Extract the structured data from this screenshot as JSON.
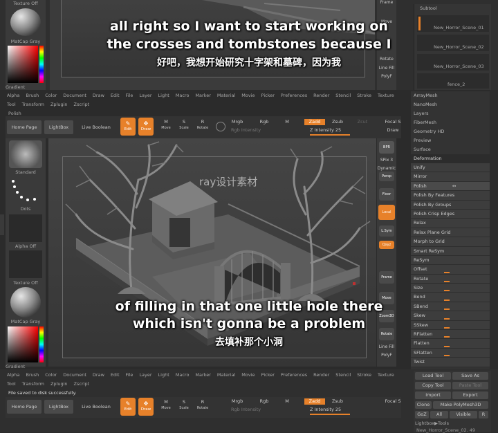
{
  "top": {
    "texture_off": "Texture Off",
    "matcap_gray": "MatCap Gray",
    "gradient": "Gradient",
    "frame": "Frame",
    "move": "Move",
    "rotate": "Rotate",
    "line_fill": "Line Fill",
    "polyf": "PolyF",
    "subtool_title": "Subtool",
    "subtools": [
      "New_Horror_Scene_01",
      "New_Horror_Scene_02",
      "New_Horror_Scene_03",
      "fence_2"
    ]
  },
  "menubar": [
    "Alpha",
    "Brush",
    "Color",
    "Document",
    "Draw",
    "Edit",
    "File",
    "Layer",
    "Light",
    "Macro",
    "Marker",
    "Material",
    "Movie",
    "Picker",
    "Preferences",
    "Render",
    "Stencil",
    "Stroke",
    "Texture"
  ],
  "menubar2": [
    "Tool",
    "Transform",
    "Zplugin",
    "Zscript"
  ],
  "mode_label": "Polish",
  "status_msg": "File saved to disk successfully.",
  "toolbar": {
    "home": "Home Page",
    "lightbox": "LightBox",
    "live_boolean": "Live Boolean",
    "edit": "Edit",
    "draw": "Draw",
    "move": "Move",
    "scale": "Scale",
    "rotate": "Rotate",
    "mrgb": "Mrgb",
    "rgb": "Rgb",
    "m": "M",
    "zadd": "Zadd",
    "zsub": "Zsub",
    "zcut": "Zcut",
    "rgb_intensity": "Rgb Intensity",
    "z_intensity": "Z Intensity 25",
    "focal": "Focal S",
    "draw_s": "Draw"
  },
  "left": {
    "standard": "Standard",
    "dots": "Dots",
    "alpha_off": "Alpha Off",
    "texture_off": "Texture Off",
    "matcap_gray": "MatCap Gray",
    "gradient": "Gradient"
  },
  "right_tools": {
    "bpr": "BPR",
    "spix": "SPix 3",
    "dynamic": "Dynamic",
    "persp": "Persp",
    "floor": "Floor",
    "local": "Local",
    "lsym": "L.Sym",
    "xyz": "Qxyz",
    "frame": "Frame",
    "move": "Move",
    "zoom3d": "Zoom3D",
    "rotate": "Rotate",
    "linefill": "Line Fill",
    "polyf": "PolyF"
  },
  "right_panel": {
    "top_items": [
      "ArrayMesh",
      "NanoMesh",
      "Layers",
      "FiberMesh",
      "Geometry HD",
      "Preview",
      "Surface"
    ],
    "section": "Deformation",
    "items": [
      "Unify",
      "Mirror",
      "Polish",
      "Polish By Features",
      "Polish By Groups",
      "Polish Crisp Edges",
      "Relax",
      "Relax Plane Grid",
      "Morph to Grid",
      "Smart ReSym",
      "ReSym",
      "Offset",
      "Rotate",
      "Size",
      "Bend",
      "SBend",
      "Skew",
      "SSkew",
      "RFlatten",
      "Flatten",
      "SFlatten",
      "Twist"
    ]
  },
  "bottom_right": {
    "rows": [
      [
        "Load Tool",
        "Save As"
      ],
      [
        "Copy Tool",
        "Paste Tool"
      ],
      [
        "Import",
        "Export"
      ],
      [
        "Clone",
        "Make PolyMesh3D"
      ],
      [
        "GoZ",
        "All",
        "Visible",
        "R"
      ]
    ],
    "lightbox_tools": "Lightbox▶Tools",
    "current": "New_Horror_Scene_02. 49"
  },
  "watermark": "ray设计素材",
  "captions": {
    "top_en_1": "all right so I want to start working on",
    "top_en_2": "the crosses and tombstones because I",
    "top_zh": "好吧，我想开始研究十字架和墓碑，因为我",
    "bottom_en_1": "of filling in that one little hole there",
    "bottom_en_2": "which isn't gonna be a problem",
    "bottom_zh": "去填补那个小洞"
  },
  "colors": {
    "accent": "#e7812a",
    "bg": "#2b2b2b",
    "panel": "#3a3a3a"
  }
}
